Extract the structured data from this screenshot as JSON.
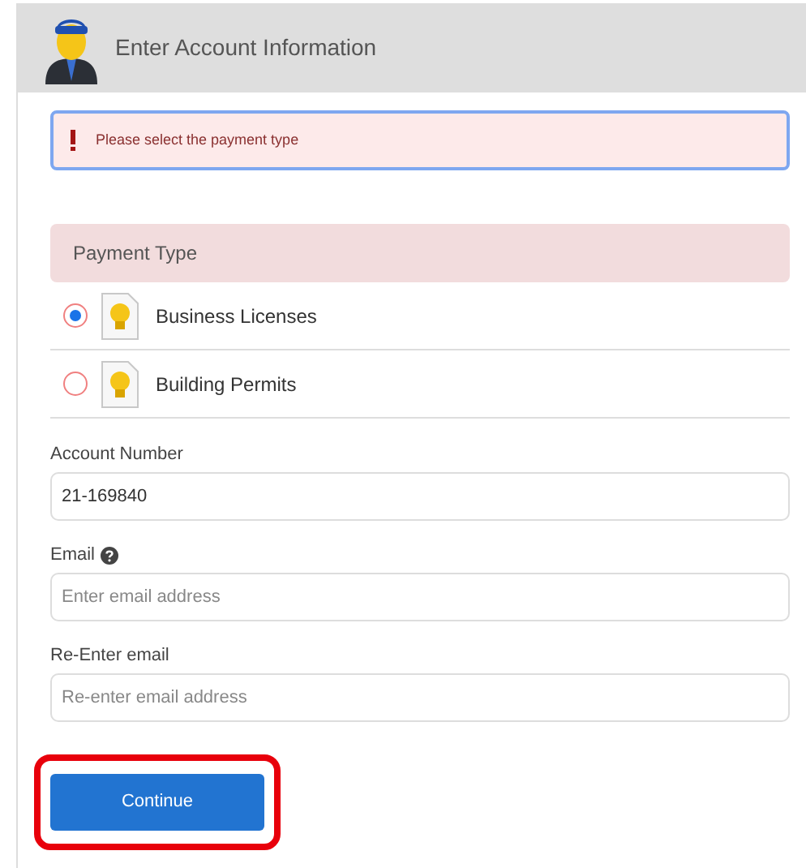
{
  "header": {
    "title": "Enter Account Information"
  },
  "alert": {
    "message": "Please select the payment type"
  },
  "payment_type": {
    "heading": "Payment Type",
    "options": [
      {
        "label": "Business Licenses",
        "selected": true
      },
      {
        "label": "Building Permits",
        "selected": false
      }
    ]
  },
  "fields": [
    {
      "label": "Account Number",
      "value": "21-169840",
      "help": false
    },
    {
      "label": "Email",
      "placeholder": "Enter email address",
      "help": true
    },
    {
      "label": "Re-Enter email",
      "placeholder": "Re-enter email address",
      "help": false
    }
  ],
  "continue_button": {
    "label": "Continue",
    "highlighted": true
  }
}
